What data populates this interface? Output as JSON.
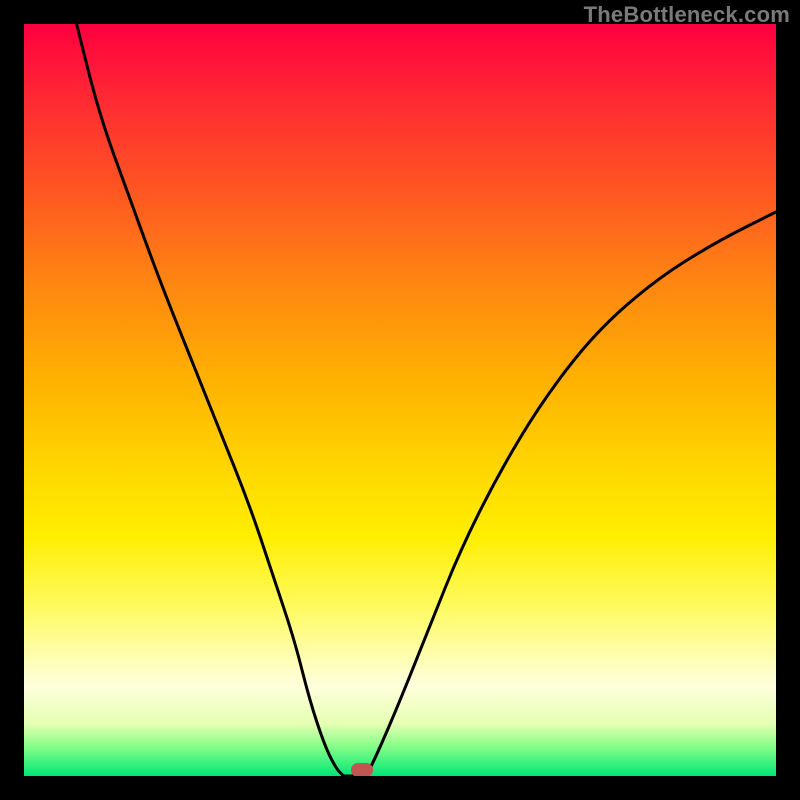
{
  "watermark": "TheBottleneck.com",
  "colors": {
    "frame": "#000000",
    "curve": "#000000",
    "marker": "#c0564f",
    "watermark": "#7a7a7a"
  },
  "chart_data": {
    "type": "line",
    "title": "",
    "xlabel": "",
    "ylabel": "",
    "xlim": [
      0,
      100
    ],
    "ylim": [
      0,
      100
    ],
    "series": [
      {
        "name": "left-branch",
        "x": [
          7,
          10,
          14,
          18,
          22,
          26,
          30,
          33,
          36,
          38,
          40,
          41.5,
          42.5
        ],
        "values": [
          100,
          88,
          77,
          66,
          56,
          46,
          36,
          27,
          18,
          10,
          4,
          1,
          0
        ]
      },
      {
        "name": "valley-floor",
        "x": [
          42.5,
          44,
          45.5
        ],
        "values": [
          0,
          0,
          0
        ]
      },
      {
        "name": "right-branch",
        "x": [
          45.5,
          47,
          50,
          54,
          58,
          63,
          69,
          76,
          84,
          92,
          100
        ],
        "values": [
          0,
          3,
          10,
          20,
          30,
          40,
          50,
          59,
          66,
          71,
          75
        ]
      }
    ],
    "annotations": [
      {
        "name": "optimal-marker",
        "x": 45,
        "y": 0
      }
    ],
    "gradient_stops": [
      {
        "pos": 0,
        "color": "#ff0040"
      },
      {
        "pos": 10,
        "color": "#ff2a33"
      },
      {
        "pos": 22,
        "color": "#ff5522"
      },
      {
        "pos": 35,
        "color": "#ff8811"
      },
      {
        "pos": 48,
        "color": "#ffb300"
      },
      {
        "pos": 60,
        "color": "#ffd900"
      },
      {
        "pos": 68,
        "color": "#ffee00"
      },
      {
        "pos": 78,
        "color": "#fffb66"
      },
      {
        "pos": 88,
        "color": "#ffffdd"
      },
      {
        "pos": 93,
        "color": "#e6ffb3"
      },
      {
        "pos": 96,
        "color": "#88ff88"
      },
      {
        "pos": 100,
        "color": "#00e676"
      }
    ]
  }
}
